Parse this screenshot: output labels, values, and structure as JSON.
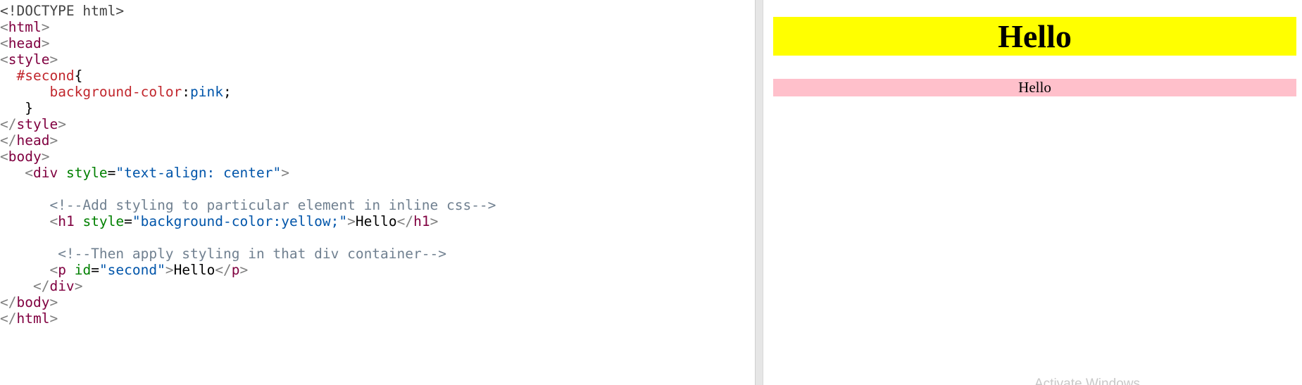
{
  "editor": {
    "lines": [
      [
        [
          "doctype",
          "<!DOCTYPE html>"
        ]
      ],
      [
        [
          "bracket",
          "<"
        ],
        [
          "tag",
          "html"
        ],
        [
          "bracket",
          ">"
        ]
      ],
      [
        [
          "bracket",
          "<"
        ],
        [
          "tag",
          "head"
        ],
        [
          "bracket",
          ">"
        ]
      ],
      [
        [
          "bracket",
          "<"
        ],
        [
          "tag",
          "style"
        ],
        [
          "bracket",
          ">"
        ]
      ],
      [
        [
          "text",
          "  "
        ],
        [
          "sel",
          "#second"
        ],
        [
          "punc",
          "{"
        ]
      ],
      [
        [
          "text",
          "      "
        ],
        [
          "prop",
          "background-color"
        ],
        [
          "punc",
          ":"
        ],
        [
          "pval",
          "pink"
        ],
        [
          "punc",
          ";"
        ]
      ],
      [
        [
          "text",
          "   "
        ],
        [
          "punc",
          "}"
        ]
      ],
      [
        [
          "bracket",
          "</"
        ],
        [
          "tag",
          "style"
        ],
        [
          "bracket",
          ">"
        ]
      ],
      [
        [
          "bracket",
          "</"
        ],
        [
          "tag",
          "head"
        ],
        [
          "bracket",
          ">"
        ]
      ],
      [
        [
          "bracket",
          "<"
        ],
        [
          "tag",
          "body"
        ],
        [
          "bracket",
          ">"
        ]
      ],
      [
        [
          "text",
          "   "
        ],
        [
          "bracket",
          "<"
        ],
        [
          "tag",
          "div"
        ],
        [
          "text",
          " "
        ],
        [
          "attr",
          "style"
        ],
        [
          "punc",
          "="
        ],
        [
          "val",
          "\"text-align: center\""
        ],
        [
          "bracket",
          ">"
        ]
      ],
      [],
      [
        [
          "text",
          "      "
        ],
        [
          "comment",
          "<!--Add styling to particular element in inline css-->"
        ]
      ],
      [
        [
          "text",
          "      "
        ],
        [
          "bracket",
          "<"
        ],
        [
          "tag",
          "h1"
        ],
        [
          "text",
          " "
        ],
        [
          "attr",
          "style"
        ],
        [
          "punc",
          "="
        ],
        [
          "val",
          "\"background-color:yellow;\""
        ],
        [
          "bracket",
          ">"
        ],
        [
          "text",
          "Hello"
        ],
        [
          "bracket",
          "</"
        ],
        [
          "tag",
          "h1"
        ],
        [
          "bracket",
          ">"
        ]
      ],
      [],
      [
        [
          "text",
          "       "
        ],
        [
          "comment",
          "<!--Then apply styling in that div container-->"
        ]
      ],
      [
        [
          "text",
          "      "
        ],
        [
          "bracket",
          "<"
        ],
        [
          "tag",
          "p"
        ],
        [
          "text",
          " "
        ],
        [
          "attr",
          "id"
        ],
        [
          "punc",
          "="
        ],
        [
          "val",
          "\"second\""
        ],
        [
          "bracket",
          ">"
        ],
        [
          "text",
          "Hello"
        ],
        [
          "bracket",
          "</"
        ],
        [
          "tag",
          "p"
        ],
        [
          "bracket",
          ">"
        ]
      ],
      [
        [
          "text",
          "    "
        ],
        [
          "bracket",
          "</"
        ],
        [
          "tag",
          "div"
        ],
        [
          "bracket",
          ">"
        ]
      ],
      [
        [
          "bracket",
          "</"
        ],
        [
          "tag",
          "body"
        ],
        [
          "bracket",
          ">"
        ]
      ],
      [
        [
          "bracket",
          "</"
        ],
        [
          "tag",
          "html"
        ],
        [
          "bracket",
          ">"
        ]
      ]
    ]
  },
  "preview": {
    "h1_text": "Hello",
    "h1_bg": "#ffff00",
    "p_text": "Hello",
    "p_bg": "#ffc0cb"
  },
  "watermark": {
    "text": "Activate Windows"
  }
}
